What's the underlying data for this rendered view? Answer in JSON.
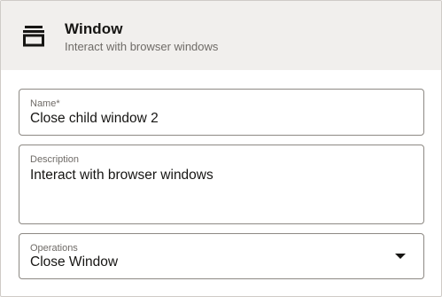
{
  "header": {
    "icon": "window-icon",
    "title": "Window",
    "subtitle": "Interact with browser windows"
  },
  "form": {
    "name": {
      "label": "Name*",
      "value": "Close child window 2"
    },
    "description": {
      "label": "Description",
      "value": "Interact with browser windows"
    },
    "operations": {
      "label": "Operations",
      "selected": "Close Window",
      "icon": "chevron-down-icon"
    }
  }
}
